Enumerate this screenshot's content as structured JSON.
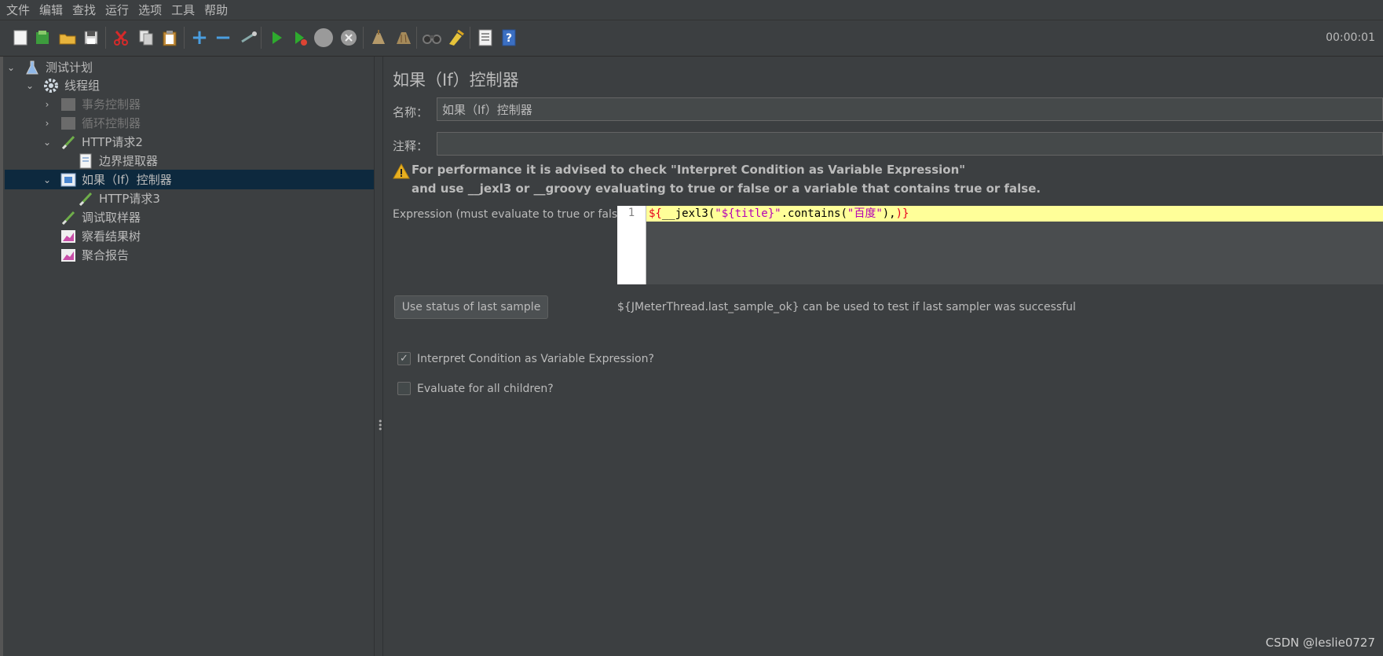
{
  "menubar": [
    "文件",
    "编辑",
    "查找",
    "运行",
    "选项",
    "工具",
    "帮助"
  ],
  "toolbar": {
    "icons": [
      "new-icon",
      "templates-icon",
      "open-icon",
      "save-icon",
      "cut-icon",
      "copy-icon",
      "paste-icon",
      "expand-icon",
      "collapse-icon",
      "toggle-icon",
      "start-icon",
      "start-no-pause-icon",
      "stop-icon",
      "shutdown-icon",
      "clear-icon",
      "clear-all-icon",
      "search-icon",
      "reset-search-icon",
      "function-helper-icon",
      "help-icon"
    ],
    "timer": "00:00:01"
  },
  "tree": [
    {
      "label": "测试计划",
      "icon": "test-plan-icon",
      "expanded": true
    },
    {
      "label": "线程组",
      "icon": "thread-group-icon",
      "expanded": true
    },
    {
      "label": "事务控制器",
      "icon": "transaction-controller-icon",
      "disabled": true
    },
    {
      "label": "循环控制器",
      "icon": "loop-controller-icon",
      "disabled": true
    },
    {
      "label": "HTTP请求2",
      "icon": "http-sampler-icon",
      "expanded": true
    },
    {
      "label": "边界提取器",
      "icon": "extractor-icon"
    },
    {
      "label": "如果（If）控制器",
      "icon": "if-controller-icon",
      "selected": true,
      "expanded": true
    },
    {
      "label": "HTTP请求3",
      "icon": "http-sampler-icon"
    },
    {
      "label": "调试取样器",
      "icon": "debug-sampler-icon"
    },
    {
      "label": "察看结果树",
      "icon": "results-tree-icon"
    },
    {
      "label": "聚合报告",
      "icon": "aggregate-report-icon"
    }
  ],
  "panel": {
    "title": "如果（If）控制器",
    "name_label": "名称：",
    "name_value": "如果（If）控制器",
    "comment_label": "注释：",
    "comment_value": "",
    "warning_line1": "For performance it is advised to check \"Interpret Condition as Variable Expression\"",
    "warning_line2": "and use __jexl3 or __groovy evaluating to true or false or a variable that contains true or false.",
    "expression_label": "Expression (must evaluate to true or false)",
    "line_number": "1",
    "expression": {
      "part1": "${",
      "part2": "__jexl3(",
      "part3": "\"${title}\"",
      "part4": ".contains(",
      "part5": "\"百度\"",
      "part6": "),",
      "part7": ")}"
    },
    "button_label": "Use status of last sample",
    "hint": "${JMeterThread.last_sample_ok} can be used to test if last sampler was successful",
    "checkbox1_label": "Interpret Condition as Variable Expression?",
    "checkbox1_checked": true,
    "checkbox2_label": "Evaluate for all children?",
    "checkbox2_checked": false
  },
  "watermark": "CSDN @leslie0727"
}
